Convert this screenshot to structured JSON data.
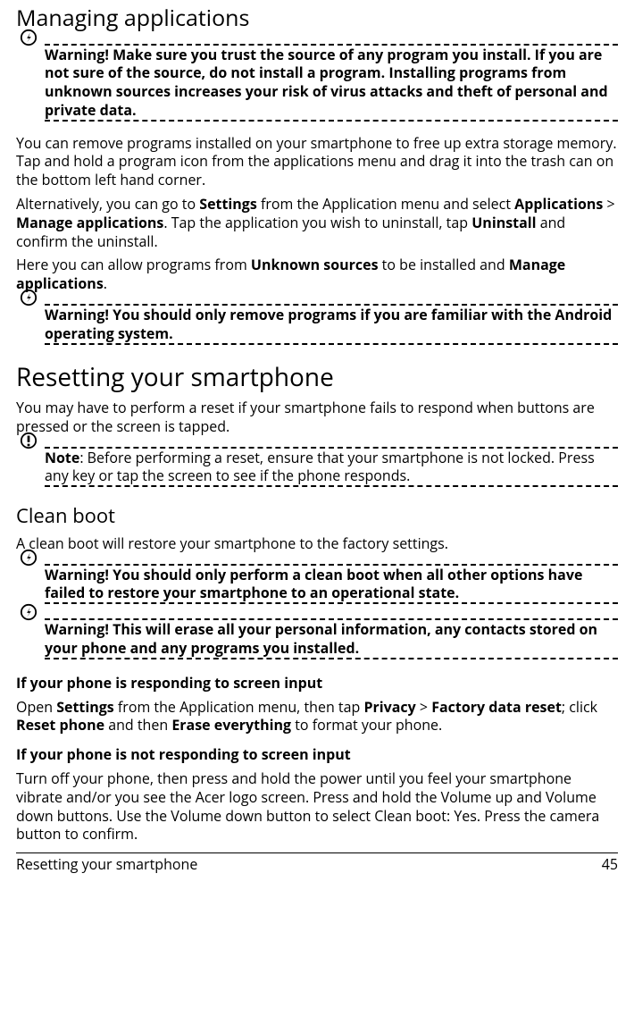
{
  "headings": {
    "managing_apps": "Managing applications",
    "resetting": "Resetting your smartphone",
    "clean_boot": "Clean boot",
    "responding": "If your phone is responding to screen input",
    "not_responding": "If your phone is not responding to screen input"
  },
  "callouts": {
    "w1": "Warning! Make sure you trust the source of any program you install. If you are not sure of the source, do not install a program. Installing programs from unknown sources increases your risk of virus attacks and theft of personal and private data.",
    "w2": "Warning! You should only remove programs if you are familiar with the Android operating system.",
    "note1_label": "Note",
    "note1_text": ": Before performing a reset, ensure that your smartphone is not locked. Press any key or tap the screen to see if the phone responds.",
    "w3": "Warning! You should only perform a clean boot when all other options have failed to restore your smartphone to an operational state.",
    "w4": "Warning! This will erase all your personal information, any contacts stored on your phone and any programs you installed."
  },
  "paras": {
    "p1": "You can remove programs installed on your smartphone to free up extra storage memory. Tap and hold a program icon from the applications menu and drag it into the trash can on the bottom left hand corner.",
    "p2a": "Alternatively, you can go to ",
    "p2b": "Settings",
    "p2c": " from the Application menu and select ",
    "p2d": "Applications",
    "p2e": " > ",
    "p2f": "Manage applications",
    "p2g": ". Tap the application you wish to uninstall, tap ",
    "p2h": "Uninstall",
    "p2i": " and confirm the uninstall.",
    "p3a": "Here you can allow programs from ",
    "p3b": "Unknown sources",
    "p3c": " to be installed and ",
    "p3d": "Manage applications",
    "p3e": ".",
    "p4": "You may have to perform a reset if your smartphone fails to respond when buttons are pressed or the screen is tapped.",
    "p5": "A clean boot will restore your smartphone to the factory settings.",
    "p6a": "Open ",
    "p6b": "Settings",
    "p6c": " from the Application menu, then tap ",
    "p6d": "Privacy",
    "p6e": " > ",
    "p6f": "Factory data reset",
    "p6g": "; click ",
    "p6h": "Reset phone",
    "p6i": " and then ",
    "p6j": "Erase everything",
    "p6k": " to format your phone.",
    "p7": "Turn off your phone, then press and hold the power until you feel your smartphone vibrate and/or you see the Acer logo screen. Press and hold the Volume up and Volume down buttons. Use the Volume down button to select Clean boot: Yes. Press the camera button to confirm."
  },
  "footer": {
    "left": "Resetting your smartphone",
    "page": "45"
  }
}
